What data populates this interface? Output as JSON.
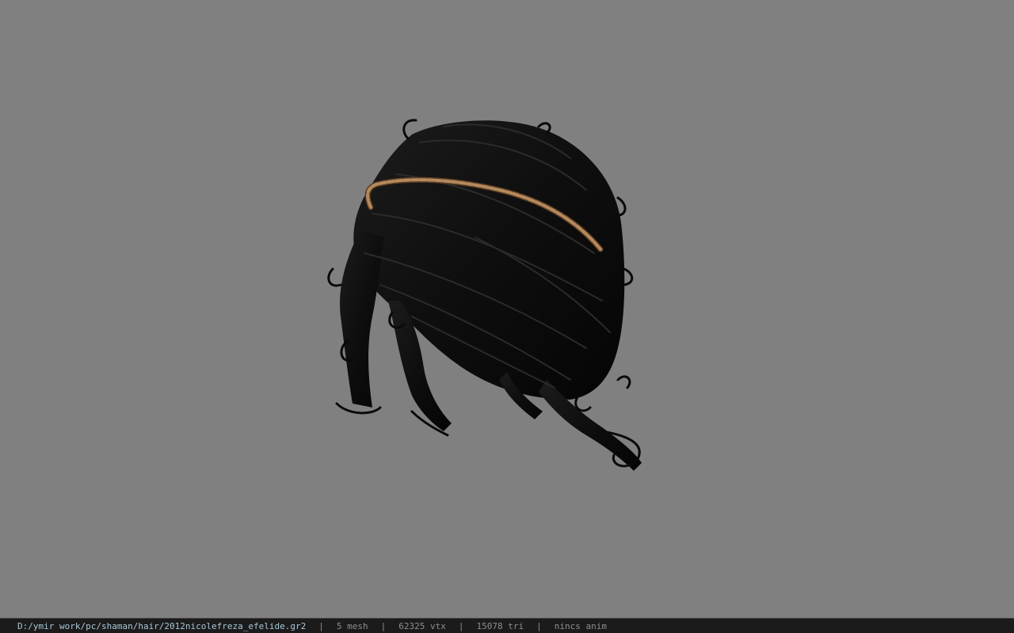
{
  "viewport": {
    "background": "#808080",
    "model": "hair-mesh",
    "accessory": "headband"
  },
  "status": {
    "file_path": "D:/ymir work/pc/shaman/hair/2012nicolefreza_efelide.gr2",
    "separator": "|",
    "mesh": "5 mesh",
    "vertices": "62325 vtx",
    "triangles": "15078 tri",
    "anim": "nincs anim"
  },
  "colors": {
    "hair": "#0f0f0f",
    "hair_highlight": "#2a2a2a",
    "headband": "#a07850",
    "status_bg": "#1b1b1b",
    "path_text": "#a8c7d8",
    "stat_text": "#8f8f8f"
  }
}
